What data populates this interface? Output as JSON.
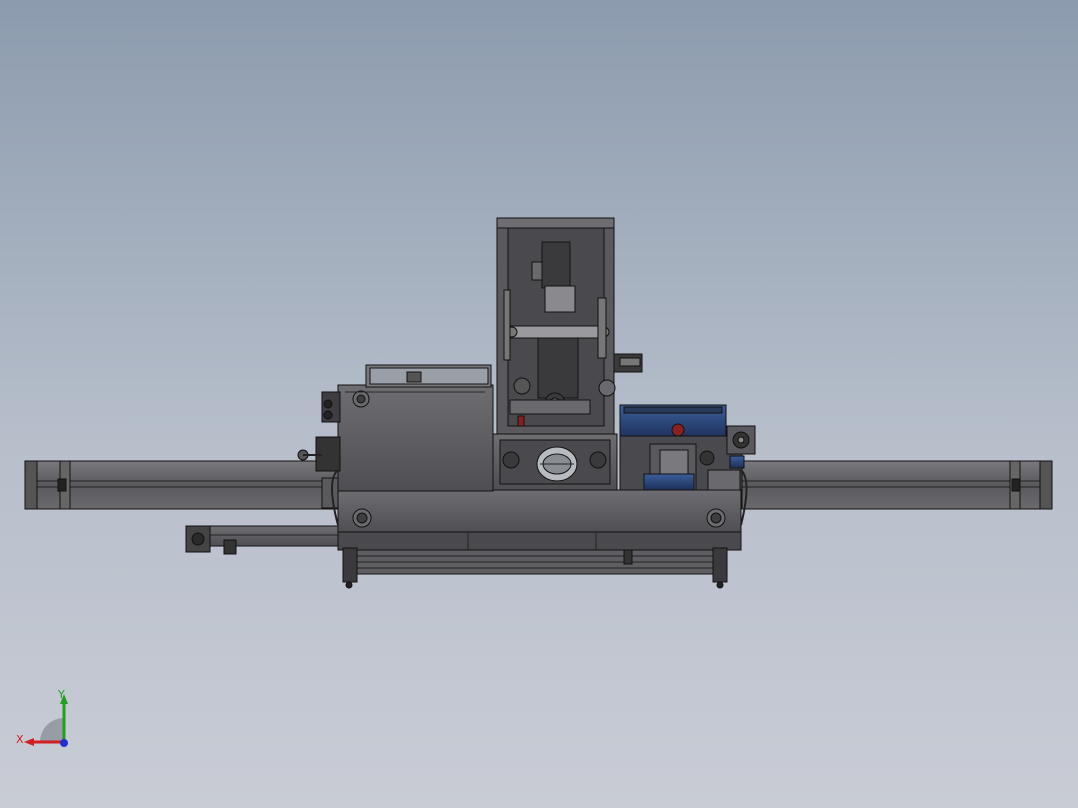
{
  "viewport": {
    "background_top": "#8c9bae",
    "background_bottom": "#c9ccd5",
    "background_mid": "#b7bfcb"
  },
  "model": {
    "frame_fill": "#5b5b5f",
    "frame_dark": "#3a3a3d",
    "edge_color": "#111111",
    "panel_fill": "#6a6a6e",
    "accent_blue": "#1d2f5a",
    "accent_blue_light": "#3b5f9a",
    "accent_red": "#8a2020",
    "window_fill": "#9aa0a8"
  },
  "triad": {
    "x_label": "X",
    "y_label": "Y",
    "x_color": "#d21f1f",
    "y_color": "#1fa01f",
    "z_color": "#1f2fd2",
    "icon": "coordinate-triad-icon"
  }
}
